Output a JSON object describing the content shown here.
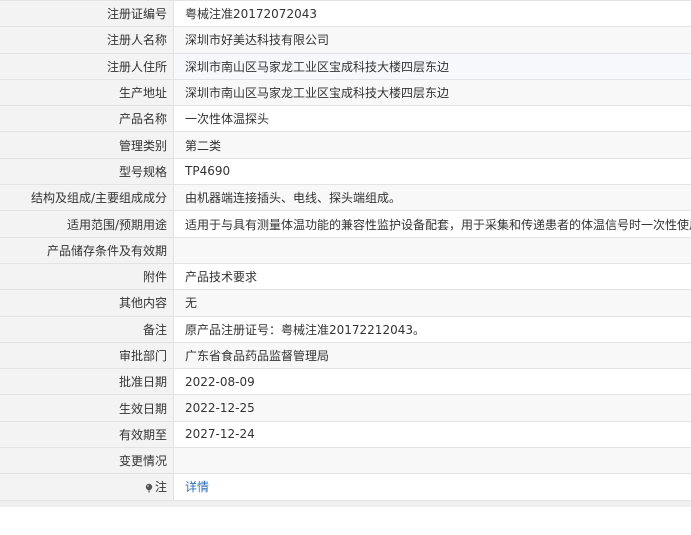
{
  "rows": [
    {
      "label": "注册证编号",
      "value": "粤械注准20172072043"
    },
    {
      "label": "注册人名称",
      "value": "深圳市好美达科技有限公司"
    },
    {
      "label": "注册人住所",
      "value": "深圳市南山区马家龙工业区宝成科技大楼四层东边"
    },
    {
      "label": "生产地址",
      "value": "深圳市南山区马家龙工业区宝成科技大楼四层东边"
    },
    {
      "label": "产品名称",
      "value": "一次性体温探头"
    },
    {
      "label": "管理类别",
      "value": "第二类"
    },
    {
      "label": "型号规格",
      "value": "TP4690"
    },
    {
      "label": "结构及组成/主要组成成分",
      "value": "由机器端连接插头、电线、探头端组成。"
    },
    {
      "label": "适用范围/预期用途",
      "value": "适用于与具有测量体温功能的兼容性监护设备配套，用于采集和传递患者的体温信号时一次性使用。"
    },
    {
      "label": "产品储存条件及有效期",
      "value": ""
    },
    {
      "label": "附件",
      "value": "产品技术要求"
    },
    {
      "label": "其他内容",
      "value": "无"
    },
    {
      "label": "备注",
      "value": "原产品注册证号：粤械注准20172212043。"
    },
    {
      "label": "审批部门",
      "value": "广东省食品药品监督管理局"
    },
    {
      "label": "批准日期",
      "value": "2022-08-09"
    },
    {
      "label": "生效日期",
      "value": "2022-12-25"
    },
    {
      "label": "有效期至",
      "value": "2027-12-24"
    },
    {
      "label": "变更情况",
      "value": ""
    },
    {
      "label": "注",
      "value": "详情",
      "icon": "pin-icon"
    }
  ]
}
